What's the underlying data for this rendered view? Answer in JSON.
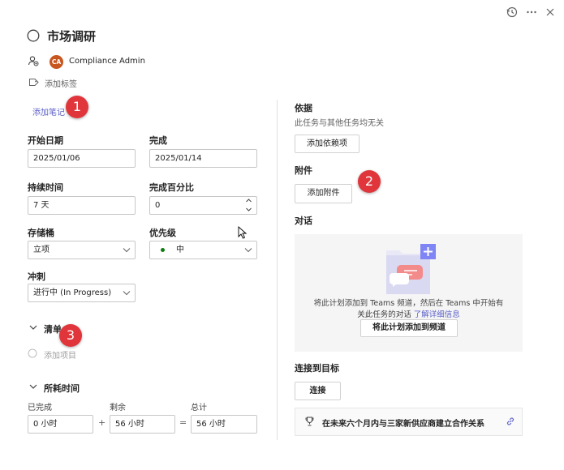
{
  "header": {
    "icons": [
      "history-icon",
      "more-icon",
      "close-icon"
    ],
    "title": "市场调研",
    "assignee": {
      "initials": "CA",
      "name": "Compliance Admin",
      "avatar_color": "#c8561f"
    },
    "add_label": "添加标签"
  },
  "left": {
    "add_note": "添加笔记",
    "start_date": {
      "label": "开始日期",
      "value": "2025/01/06"
    },
    "due_date": {
      "label": "完成",
      "value": "2025/01/14"
    },
    "duration": {
      "label": "持续时间",
      "value": "7 天"
    },
    "percent": {
      "label": "完成百分比",
      "value": "0"
    },
    "bucket": {
      "label": "存储桶",
      "value": "立项"
    },
    "priority": {
      "label": "优先级",
      "value": "中",
      "dot_color": "#107c10"
    },
    "sprint": {
      "label": "冲刺",
      "value": "进行中 (In Progress)"
    },
    "checklist": {
      "title": "清单",
      "add_item": "添加项目"
    },
    "effort": {
      "title": "所耗时间",
      "completed": {
        "label": "已完成",
        "value": "0 小时"
      },
      "remaining": {
        "label": "剩余",
        "value": "56 小时"
      },
      "total": {
        "label": "总计",
        "value": "56 小时"
      },
      "plus": "+",
      "equals": "="
    }
  },
  "right": {
    "dependencies": {
      "title": "依据",
      "desc": "此任务与其他任务均无关",
      "button": "添加依赖项"
    },
    "attachments": {
      "title": "附件",
      "button": "添加附件"
    },
    "conversation": {
      "title": "对话",
      "text_line1": "将此计划添加到 Teams 频道，然后在 Teams 中开始有",
      "text_line2": "关此任务的对话",
      "learn_more": "了解详细信息",
      "button": "将此计划添加到频道"
    },
    "goals": {
      "title": "连接到目标",
      "button": "连接",
      "goal_text": "在未来六个月内与三家新供应商建立合作关系"
    }
  },
  "annotations": [
    "1",
    "2",
    "3"
  ],
  "colors": {
    "accent": "#5b5fc7",
    "badge": "#e0353b",
    "divider": "#e0e0e0"
  }
}
